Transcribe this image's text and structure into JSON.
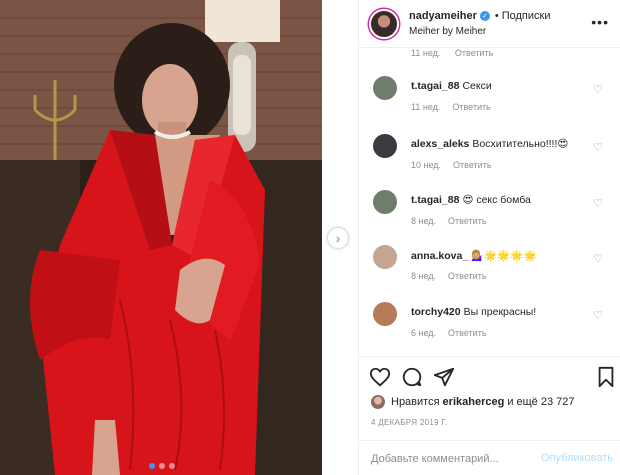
{
  "post": {
    "header": {
      "username": "nadyameiher",
      "verified_glyph": "✓",
      "separator": "•",
      "follow_label": "Подписки",
      "subtitle": "Meiher by Meiher",
      "more_glyph": "•••"
    },
    "partial_comment": {
      "time": "11 нед.",
      "reply_label": "Ответить"
    },
    "comments": [
      {
        "username": "t.tagai_88",
        "text": "Секси",
        "time": "11 нед.",
        "reply_label": "Ответить",
        "avatar_color": "#6e7e6a"
      },
      {
        "username": "alexs_aleks",
        "text": "Восхитительно!!!!😍",
        "time": "10 нед.",
        "reply_label": "Ответить",
        "avatar_color": "#3b3a40"
      },
      {
        "username": "t.tagai_88",
        "text": "😍 секс бомба",
        "time": "8 нед.",
        "reply_label": "Ответить",
        "avatar_color": "#6e7e6a"
      },
      {
        "username": "anna.kova_",
        "text": "💁🏼‍♀️🌟🌟🌟🌟",
        "time": "8 нед.",
        "reply_label": "Ответить",
        "avatar_color": "#c4a58f"
      },
      {
        "username": "torchy420",
        "text": "Вы прекрасны!",
        "time": "6 нед.",
        "reply_label": "Ответить",
        "avatar_color": "#b57a5a"
      }
    ],
    "likes": {
      "prefix": "Нравится",
      "user": "erikaherceg",
      "suffix": "и ещё 23 727"
    },
    "date": "4 ДЕКАБРЯ 2019 Г.",
    "add_comment": {
      "placeholder": "Добавьте комментарий...",
      "publish_label": "Опубликовать"
    },
    "carousel": {
      "next_glyph": "›",
      "count": 3,
      "active_index": 0
    }
  },
  "colors": {
    "accent": "#3897f0",
    "muted": "#8e8e8e",
    "border": "#efefef",
    "publish_disabled": "#b2dffc",
    "dress": "#d8141b"
  }
}
